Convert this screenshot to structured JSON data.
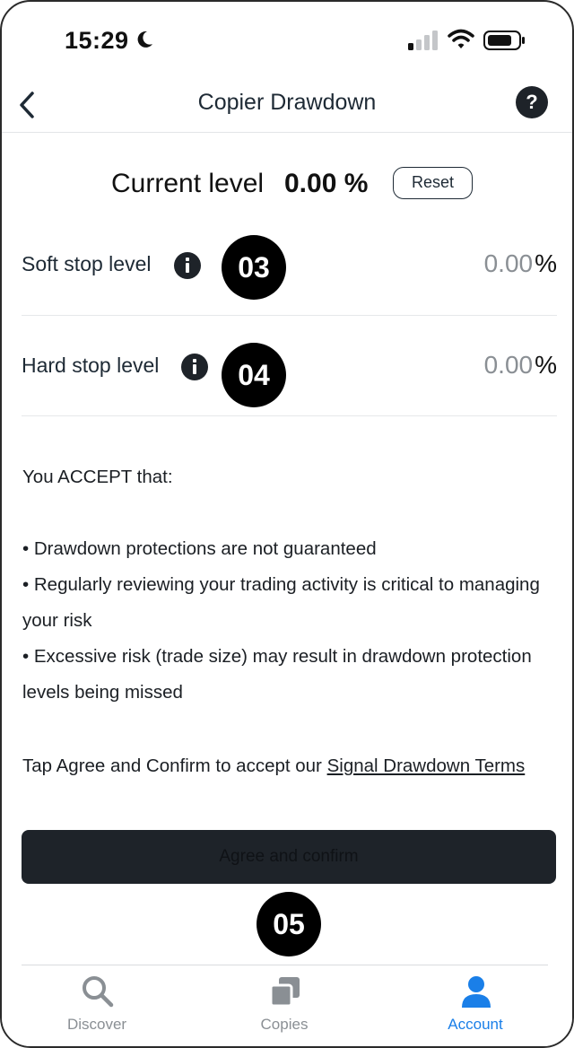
{
  "status_bar": {
    "time": "15:29"
  },
  "header": {
    "title": "Copier Drawdown",
    "help_label": "?"
  },
  "current_level": {
    "label": "Current level",
    "value": "0.00 %",
    "reset_label": "Reset"
  },
  "stops": [
    {
      "label": "Soft stop level",
      "badge": "03",
      "value": "0.00",
      "unit": "%"
    },
    {
      "label": "Hard stop level",
      "badge": "04",
      "value": "0.00",
      "unit": "%"
    }
  ],
  "terms": {
    "heading": "You ACCEPT that:",
    "bullets": [
      "• Drawdown protections are not guaranteed",
      "• Regularly reviewing your trading activity is critical to managing your risk",
      "• Excessive risk (trade size) may result in drawdown protection levels being missed"
    ],
    "tap_text": "Tap Agree and Confirm to accept our ",
    "link_text": "Signal Drawdown Terms"
  },
  "agree_button": {
    "label": "Agree and confirm",
    "badge": "05"
  },
  "tabs": [
    {
      "label": "Discover",
      "icon": "search-icon"
    },
    {
      "label": "Copies",
      "icon": "copies-icon"
    },
    {
      "label": "Account",
      "icon": "person-icon",
      "active": true
    }
  ],
  "colors": {
    "accent": "#1a7fe8",
    "dark": "#1e2329",
    "muted": "#8a8f94"
  }
}
